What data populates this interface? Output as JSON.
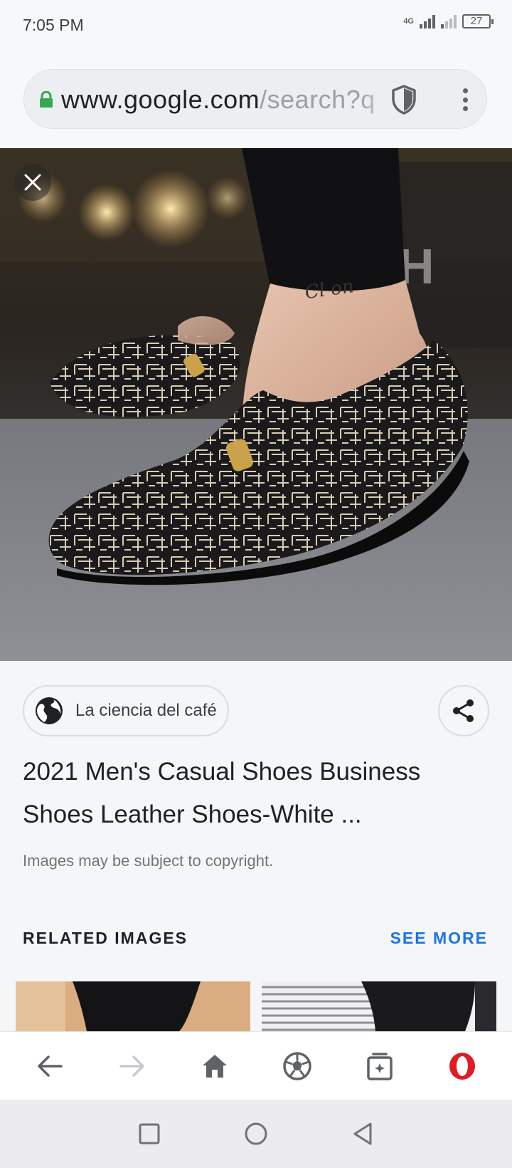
{
  "status_bar": {
    "time": "7:05 PM",
    "network_label": "4G",
    "battery": "27"
  },
  "browser": {
    "url_host": "www.google.com",
    "url_path": "/search?q"
  },
  "result": {
    "source_label": "La ciencia del café",
    "title": "2021 Men's Casual Shoes Business Shoes Leather Shoes-White ...",
    "copyright_note": "Images may be subject to copyright."
  },
  "related": {
    "heading": "RELATED IMAGES",
    "see_more": "SEE MORE"
  },
  "icons": {
    "close": "close-icon",
    "share": "share-icon",
    "globe": "globe-icon",
    "lock": "lock-icon",
    "shield": "shield-icon",
    "menu": "kebab-menu-icon",
    "back": "back-arrow-icon",
    "forward": "forward-arrow-icon",
    "home": "home-icon",
    "soccer": "soccer-ball-icon",
    "tabs": "tabs-icon",
    "opera": "opera-logo-icon"
  },
  "colors": {
    "accent": "#1a73e8",
    "secure_lock": "#34a853",
    "opera_red": "#e01b24"
  }
}
